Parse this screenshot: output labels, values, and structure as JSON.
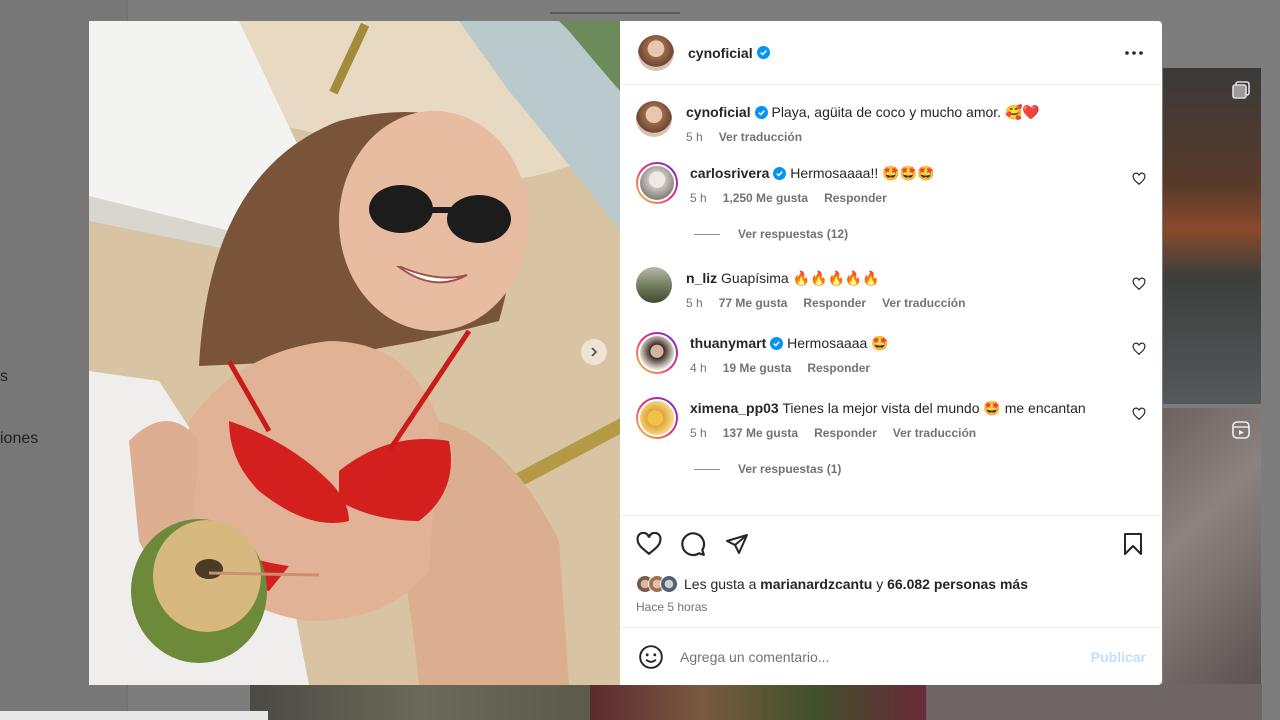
{
  "background": {
    "sidebar_fragments": [
      "s",
      "iones"
    ]
  },
  "post": {
    "author": "cynoficial",
    "caption": "Playa, agüita de coco y mucho amor. 🥰❤️",
    "caption_time": "5 h",
    "caption_translate": "Ver traducción"
  },
  "comments": [
    {
      "user": "carlosrivera",
      "verified": true,
      "text": "Hermosaaaa!! 🤩🤩🤩",
      "time": "5 h",
      "likes": "1,250 Me gusta",
      "reply": "Responder",
      "translate": "",
      "view_replies": "Ver respuestas (12)"
    },
    {
      "user": "n_liz",
      "verified": false,
      "text": "Guapísima 🔥🔥🔥🔥🔥",
      "time": "5 h",
      "likes": "77 Me gusta",
      "reply": "Responder",
      "translate": "Ver traducción",
      "view_replies": ""
    },
    {
      "user": "thuanymart",
      "verified": true,
      "text": "Hermosaaaa 🤩",
      "time": "4 h",
      "likes": "19 Me gusta",
      "reply": "Responder",
      "translate": "",
      "view_replies": ""
    },
    {
      "user": "ximena_pp03",
      "verified": false,
      "text": "Tienes la mejor vista del mundo 🤩 me encantan",
      "time": "5 h",
      "likes": "137 Me gusta",
      "reply": "Responder",
      "translate": "Ver traducción",
      "view_replies": "Ver respuestas (1)"
    }
  ],
  "likes": {
    "prefix": "Les gusta a",
    "user": "marianardzcantu",
    "connector": "y",
    "others": "66.082 personas más",
    "posted": "Hace 5 horas"
  },
  "composer": {
    "placeholder": "Agrega un comentario...",
    "publish_label": "Publicar"
  },
  "colors": {
    "verified": "#0095f6",
    "publish_disabled": "#c0dffd",
    "secondary_text": "#737373"
  }
}
